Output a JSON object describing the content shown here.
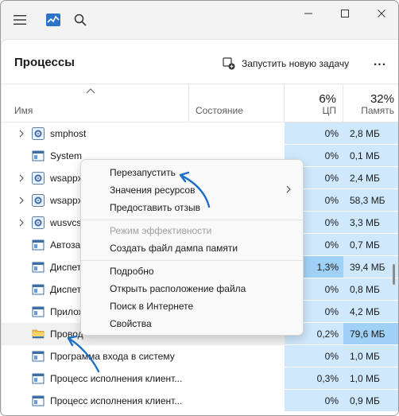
{
  "page": {
    "title": "Процессы"
  },
  "toolbar": {
    "run_task_label": "Запустить новую задачу",
    "more_label": "..."
  },
  "columns": {
    "name": "Имя",
    "state": "Состояние",
    "cpu": {
      "percent": "6%",
      "label": "ЦП"
    },
    "memory": {
      "percent": "32%",
      "label": "Память"
    }
  },
  "rows": [
    {
      "name": "smphost",
      "state": "",
      "cpu": "0%",
      "memory": "2,8 МБ",
      "icon": "gear-icon",
      "expandable": true
    },
    {
      "name": "System",
      "state": "",
      "cpu": "0%",
      "memory": "0,1 МБ",
      "icon": "window-icon",
      "expandable": false
    },
    {
      "name": "wsappx",
      "state": "",
      "cpu": "0%",
      "memory": "2,4 МБ",
      "icon": "gear-icon",
      "expandable": true
    },
    {
      "name": "wsappx",
      "state": "",
      "cpu": "0%",
      "memory": "58,3 МБ",
      "icon": "gear-icon",
      "expandable": true
    },
    {
      "name": "wusvcs",
      "state": "",
      "cpu": "0%",
      "memory": "3,3 МБ",
      "icon": "gear-icon",
      "expandable": true
    },
    {
      "name": "Автоза",
      "state": "",
      "cpu": "0%",
      "memory": "0,7 МБ",
      "icon": "window-icon",
      "expandable": false
    },
    {
      "name": "Диспет",
      "state": "",
      "cpu": "1,3%",
      "memory": "39,4 МБ",
      "icon": "window-icon",
      "expandable": false
    },
    {
      "name": "Диспет",
      "state": "",
      "cpu": "0%",
      "memory": "0,8 МБ",
      "icon": "window-icon",
      "expandable": false
    },
    {
      "name": "Прилож",
      "state": "",
      "cpu": "0%",
      "memory": "4,2 МБ",
      "icon": "window-icon",
      "expandable": false
    },
    {
      "name": "Провод",
      "state": "",
      "cpu": "0,2%",
      "memory": "79,6 МБ",
      "icon": "folder-icon",
      "expandable": false
    },
    {
      "name": "Программа входа в систему",
      "state": "",
      "cpu": "0%",
      "memory": "1,0 МБ",
      "icon": "window-icon",
      "expandable": false
    },
    {
      "name": "Процесс исполнения клиент...",
      "state": "",
      "cpu": "0,3%",
      "memory": "1,0 МБ",
      "icon": "window-icon",
      "expandable": false
    },
    {
      "name": "Процесс исполнения клиент...",
      "state": "",
      "cpu": "0%",
      "memory": "0,9 МБ",
      "icon": "window-icon",
      "expandable": false
    }
  ],
  "context_menu": {
    "items": [
      {
        "label": "Перезапустить"
      },
      {
        "label": "Значения ресурсов"
      },
      {
        "label": "Предоставить отзыв"
      },
      {
        "label": "Режим эффективности"
      },
      {
        "label": "Создать файл дампа памяти"
      },
      {
        "label": "Подробно"
      },
      {
        "label": "Открыть расположение файла"
      },
      {
        "label": "Поиск в Интернете"
      },
      {
        "label": "Свойства"
      }
    ]
  },
  "colors": {
    "accent": "#0b5cad",
    "usage_low": "#cfe8fb",
    "usage_high": "#9fd0f6",
    "annotation": "#1f6fc5"
  }
}
